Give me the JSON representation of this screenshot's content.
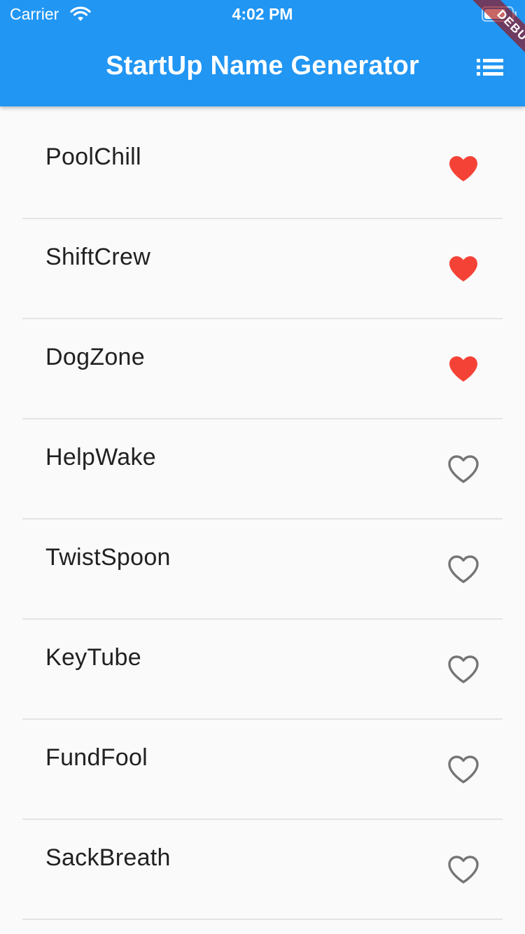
{
  "status_bar": {
    "carrier": "Carrier",
    "time": "4:02 PM",
    "wifi_icon": "wifi-icon",
    "battery_icon": "battery-icon"
  },
  "app_bar": {
    "title": "StartUp Name Generator",
    "action_icon": "list-icon",
    "background_color": "#2196f3"
  },
  "debug_banner": {
    "label": "DEBUG"
  },
  "colors": {
    "saved_heart": "#f44336",
    "unsaved_heart": "#757575",
    "divider": "#e4e4e4",
    "background": "#fafafa"
  },
  "suggestions": [
    {
      "name": "PoolChill",
      "saved": true
    },
    {
      "name": "ShiftCrew",
      "saved": true
    },
    {
      "name": "DogZone",
      "saved": true
    },
    {
      "name": "HelpWake",
      "saved": false
    },
    {
      "name": "TwistSpoon",
      "saved": false
    },
    {
      "name": "KeyTube",
      "saved": false
    },
    {
      "name": "FundFool",
      "saved": false
    },
    {
      "name": "SackBreath",
      "saved": false
    }
  ]
}
